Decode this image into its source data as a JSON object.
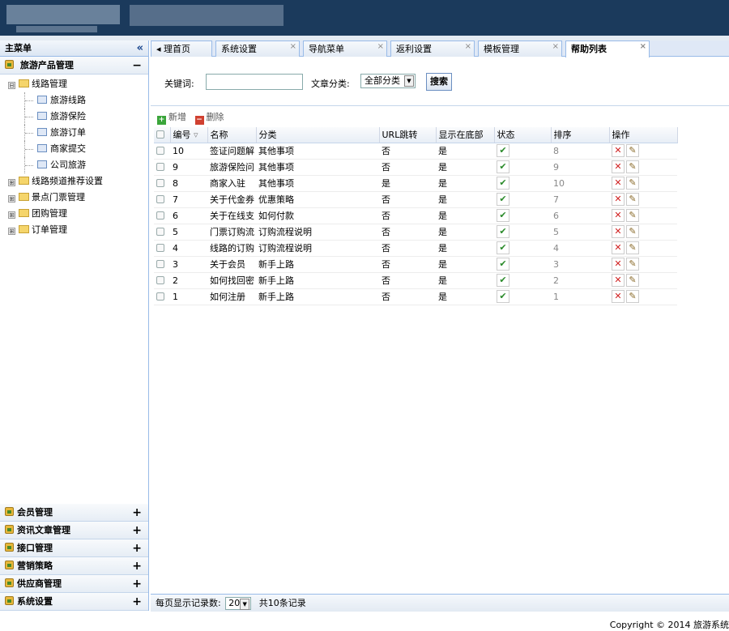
{
  "sidebar": {
    "title": "主菜单",
    "collapse_glyph": "«",
    "open_group": {
      "label": "旅游产品管理",
      "toggle": "−"
    },
    "tree": [
      {
        "label": "线路管理",
        "box": "⊟",
        "children": [
          "旅游线路",
          "旅游保险",
          "旅游订单",
          "商家提交",
          "公司旅游"
        ]
      },
      {
        "label": "线路频道推荐设置",
        "box": "⊞"
      },
      {
        "label": "景点门票管理",
        "box": "⊞"
      },
      {
        "label": "团购管理",
        "box": "⊞"
      },
      {
        "label": "订单管理",
        "box": "⊞"
      }
    ],
    "bottom_groups": [
      "会员管理",
      "资讯文章管理",
      "接口管理",
      "营销策略",
      "供应商管理",
      "系统设置"
    ],
    "expand_glyph": "+"
  },
  "tabs": [
    {
      "label": "◂ 理首页",
      "closable": false
    },
    {
      "label": "系统设置",
      "closable": true
    },
    {
      "label": "导航菜单",
      "closable": true
    },
    {
      "label": "返利设置",
      "closable": true
    },
    {
      "label": "模板管理",
      "closable": true
    },
    {
      "label": "帮助列表",
      "closable": true,
      "active": true
    }
  ],
  "search": {
    "keyword_label": "关键词:",
    "keyword_value": "",
    "category_label": "文章分类:",
    "category_value": "全部分类",
    "button": "搜索"
  },
  "toolbar": {
    "add": "新增",
    "delete": "删除"
  },
  "grid": {
    "columns": [
      "编号",
      "名称",
      "分类",
      "URL跳转",
      "显示在底部",
      "状态",
      "排序",
      "操作"
    ],
    "rows": [
      {
        "id": "10",
        "name": "签证问题解",
        "category": "其他事项",
        "url": "否",
        "bottom": "是",
        "sort": "8"
      },
      {
        "id": "9",
        "name": "旅游保险问",
        "category": "其他事项",
        "url": "否",
        "bottom": "是",
        "sort": "9"
      },
      {
        "id": "8",
        "name": "商家入驻",
        "category": "其他事项",
        "url": "是",
        "bottom": "是",
        "sort": "10"
      },
      {
        "id": "7",
        "name": "关于代金券",
        "category": "优惠策略",
        "url": "否",
        "bottom": "是",
        "sort": "7"
      },
      {
        "id": "6",
        "name": "关于在线支",
        "category": "如何付款",
        "url": "否",
        "bottom": "是",
        "sort": "6"
      },
      {
        "id": "5",
        "name": "门票订购流",
        "category": "订购流程说明",
        "url": "否",
        "bottom": "是",
        "sort": "5"
      },
      {
        "id": "4",
        "name": "线路的订购",
        "category": "订购流程说明",
        "url": "否",
        "bottom": "是",
        "sort": "4"
      },
      {
        "id": "3",
        "name": "关于会员",
        "category": "新手上路",
        "url": "否",
        "bottom": "是",
        "sort": "3"
      },
      {
        "id": "2",
        "name": "如何找回密",
        "category": "新手上路",
        "url": "否",
        "bottom": "是",
        "sort": "2"
      },
      {
        "id": "1",
        "name": "如何注册",
        "category": "新手上路",
        "url": "否",
        "bottom": "是",
        "sort": "1"
      }
    ],
    "status_glyph": "✔",
    "delete_glyph": "✕",
    "edit_glyph": "✎"
  },
  "footer": {
    "page_size_label": "每页显示记录数:",
    "page_size": "20",
    "total": "共10条记录"
  },
  "copyright": "Copyright © 2014 旅游系统"
}
